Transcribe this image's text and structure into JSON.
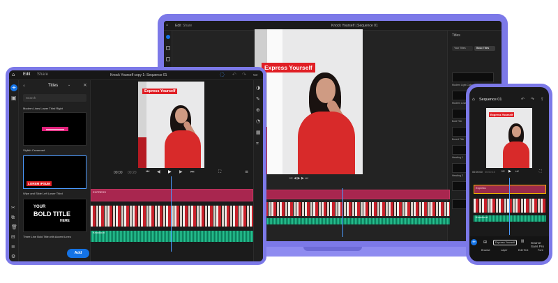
{
  "laptop": {
    "window_title": "Knock Yourself | Sequence 01",
    "tabs": [
      "Edit",
      "Share"
    ],
    "caption": "Express Yourself",
    "panel_title": "Titles",
    "panel_tabs": [
      "Your Titles",
      "Basic Titles"
    ],
    "thumbs": [
      "Modern Light Callout",
      "Modern Message",
      "Modern Lower Third",
      "Bold Title",
      "Boxed Title",
      "Heading 1",
      "Heading 2"
    ]
  },
  "tablet": {
    "tabs": {
      "edit": "Edit",
      "share": "Share"
    },
    "window_title": "Knock Yourself copy 1: Sequence 01",
    "panel_title": "Titles",
    "search_placeholder": "Search",
    "cards": [
      {
        "label": "Stylish Crossroad",
        "badge": ""
      },
      {
        "label": "Wipe and Slide Left Lower Third",
        "badge": "LOREM IPSUM"
      },
      {
        "label": "Three Line Bold Title with Accent Lines",
        "text_lines": [
          "YOUR",
          "BOLD TITLE",
          "HERE"
        ]
      }
    ],
    "first_card_label": "Modern Lines Lower Third Right",
    "add_button": "Add",
    "caption": "Express Yourself",
    "timecode": "00:00",
    "duration": "00:20",
    "tracks": {
      "title": "EXPRESS",
      "audio": "Knockout"
    }
  },
  "phone": {
    "sequence_title": "Sequence 01",
    "caption": "Express Yourself",
    "timecode": "00:00:00",
    "duration": "00:00:15",
    "tracks": {
      "title": "Express",
      "audio": "Knockout"
    },
    "toolbar": {
      "browse": "Browse",
      "layer_chip": "Express Yourself",
      "layer": "Layer",
      "edit_text": "Edit Text",
      "font": "Source Sans Pro",
      "font_label": "Font"
    }
  },
  "colors": {
    "frame": "#7c79e8",
    "accent": "#1473e6",
    "caption_red": "#e01f25",
    "title_track": "#a8264f",
    "audio_track": "#0b7a59"
  }
}
